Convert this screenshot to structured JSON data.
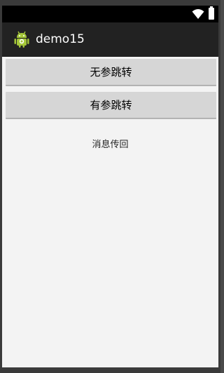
{
  "status_bar": {
    "icons": [
      "wifi-icon",
      "battery-icon"
    ]
  },
  "action_bar": {
    "app_icon": "android-icon",
    "title": "demo15"
  },
  "main": {
    "button_no_param": "无参跳转",
    "button_with_param": "有参跳转",
    "message": "消息传回"
  },
  "colors": {
    "action_bar_bg": "#222222",
    "content_bg": "#f3f3f3",
    "button_bg": "#d6d6d6",
    "android_green": "#a4c639"
  }
}
